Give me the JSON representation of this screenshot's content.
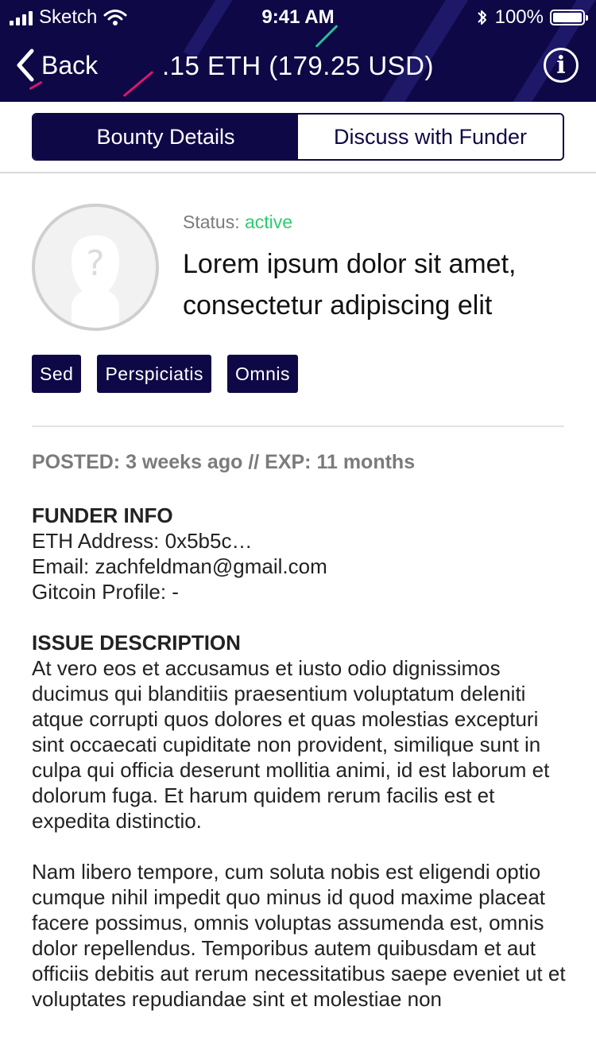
{
  "status_bar": {
    "carrier": "Sketch",
    "time": "9:41 AM",
    "battery": "100%"
  },
  "nav": {
    "back_label": "Back",
    "title": ".15 ETH (179.25 USD)",
    "info_icon": "i"
  },
  "tabs": [
    {
      "label": "Bounty Details",
      "active": true
    },
    {
      "label": "Discuss with Funder",
      "active": false
    }
  ],
  "bounty": {
    "status_label": "Status:",
    "status_value": "active",
    "title": "Lorem ipsum dolor sit amet, consectetur adipiscing elit",
    "tags": [
      "Sed",
      "Perspiciatis",
      "Omnis"
    ],
    "posted": "POSTED: 3 weeks ago // EXP: 11 months"
  },
  "funder_info": {
    "heading": "FUNDER INFO",
    "eth_address": "ETH Address: 0x5b5c…",
    "email": "Email: zachfeldman@gmail.com",
    "gitcoin_profile": "Gitcoin Profile: -"
  },
  "issue_description": {
    "heading": "ISSUE DESCRIPTION",
    "paragraphs": [
      "At vero eos et accusamus et iusto odio dignissimos ducimus qui blanditiis praesentium voluptatum deleniti atque corrupti quos dolores et quas molestias excepturi sint occaecati cupiditate non provident, similique sunt in culpa qui officia deserunt mollitia animi, id est laborum et dolorum fuga. Et harum quidem rerum facilis est et expedita distinctio.",
      "Nam libero tempore, cum soluta nobis est eligendi optio cumque nihil impedit quo minus id quod maxime placeat facere possimus, omnis voluptas assumenda est, omnis dolor repellendus. Temporibus autem quibusdam et aut officiis debitis aut rerum necessitatibus saepe eveniet ut et voluptates repudiandae sint et molestiae non"
    ]
  },
  "colors": {
    "brand_navy": "#0f0846",
    "status_active": "#2ecc71",
    "muted_text": "#7b7b7b"
  },
  "icons": {
    "back": "chevron-left-icon",
    "info": "info-icon",
    "avatar": "unknown-user-icon",
    "wifi": "wifi-icon",
    "bluetooth": "bluetooth-icon",
    "battery": "battery-icon",
    "signal": "signal-icon"
  }
}
